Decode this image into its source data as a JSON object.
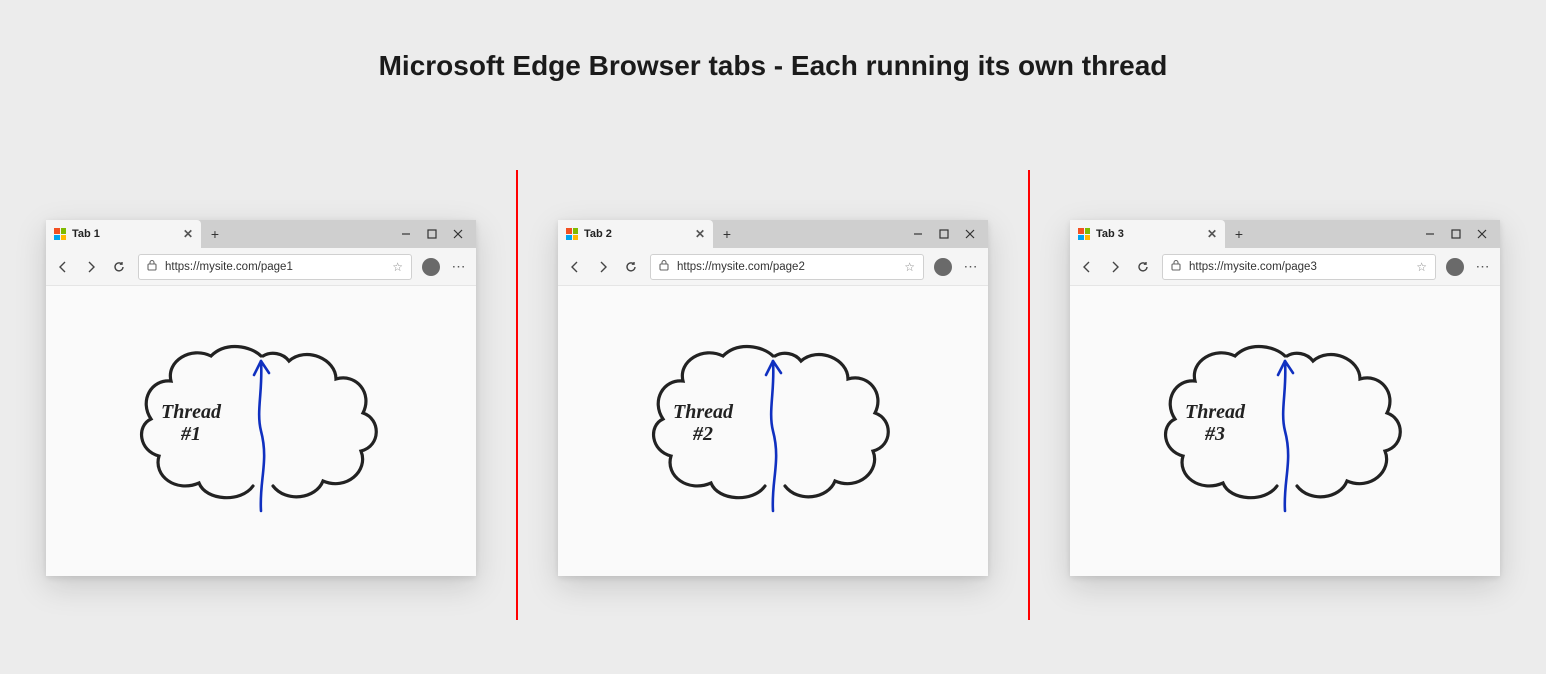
{
  "title": "Microsoft Edge Browser tabs - Each running its own thread",
  "browsers": [
    {
      "tab": "Tab 1",
      "url": "https://mysite.com/page1",
      "thread_line1": "Thread",
      "thread_line2": "#1"
    },
    {
      "tab": "Tab 2",
      "url": "https://mysite.com/page2",
      "thread_line1": "Thread",
      "thread_line2": "#2"
    },
    {
      "tab": "Tab 3",
      "url": "https://mysite.com/page3",
      "thread_line1": "Thread",
      "thread_line2": "#3"
    }
  ]
}
